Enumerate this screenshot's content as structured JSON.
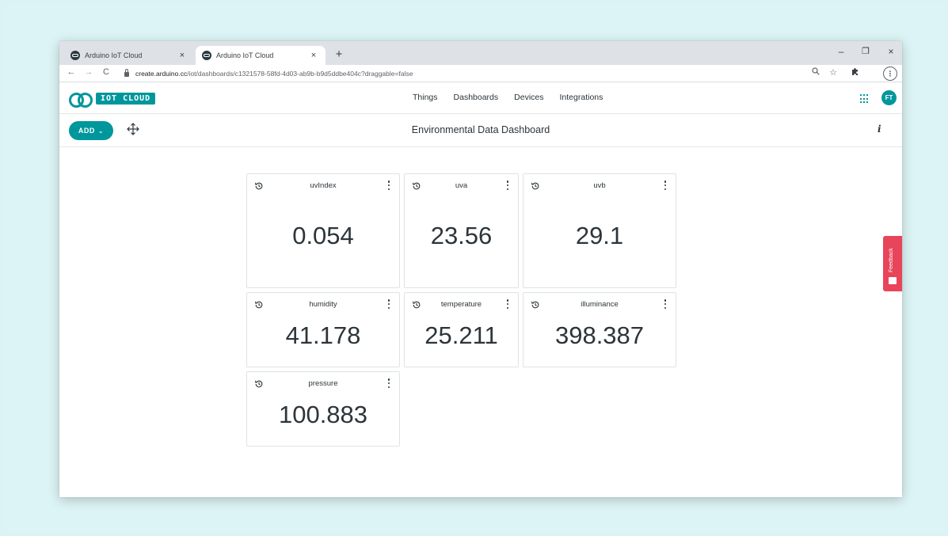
{
  "browser": {
    "tabs": [
      {
        "title": "Arduino IoT Cloud",
        "close": "×"
      },
      {
        "title": "Arduino IoT Cloud",
        "close": "×"
      }
    ],
    "new_tab": "+",
    "window_controls": {
      "minimize": "–",
      "maximize": "❐",
      "close": "×"
    },
    "url_host": "create.arduino.cc",
    "url_path": "/iot/dashboards/c1321578-58fd-4d03-ab9b-b9d5ddbe404c?draggable=false"
  },
  "app": {
    "logo_text": "IOT CLOUD",
    "nav": [
      "Things",
      "Dashboards",
      "Devices",
      "Integrations"
    ],
    "avatar_initials": "FT",
    "accent_color": "#00979c"
  },
  "dashboard": {
    "add_label": "ADD",
    "title": "Environmental Data Dashboard",
    "info_label": "i"
  },
  "widgets": [
    {
      "name": "uvIndex",
      "value": "0.054"
    },
    {
      "name": "uva",
      "value": "23.56"
    },
    {
      "name": "uvb",
      "value": "29.1"
    },
    {
      "name": "humidity",
      "value": "41.178"
    },
    {
      "name": "temperature",
      "value": "25.211"
    },
    {
      "name": "illuminance",
      "value": "398.387"
    },
    {
      "name": "pressure",
      "value": "100.883"
    }
  ],
  "feedback_label": "Feedback",
  "icons": {
    "history": "history-icon",
    "more": "more-vertical-icon",
    "move": "move-icon",
    "apps": "apps-grid-icon"
  }
}
